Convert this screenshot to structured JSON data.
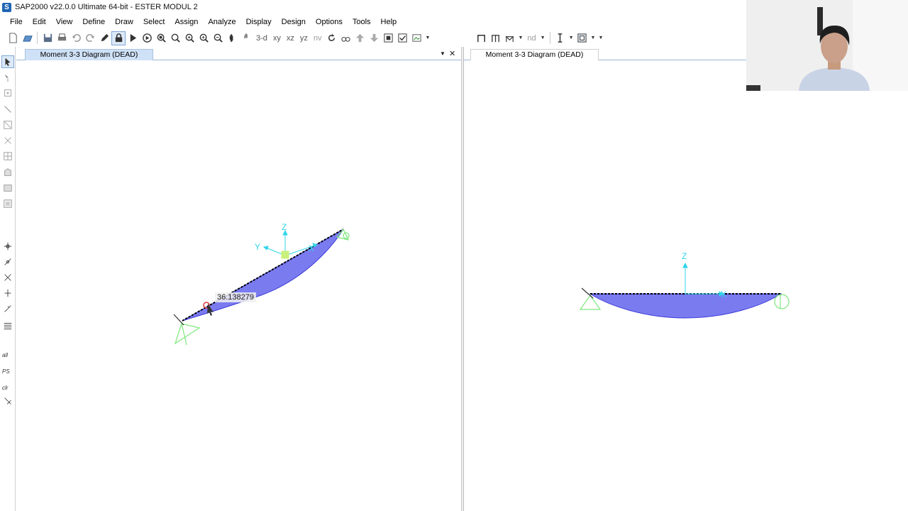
{
  "window": {
    "app_icon_letter": "S",
    "title": "SAP2000 v22.0.0 Ultimate 64-bit - ESTER MODUL 2"
  },
  "menu": {
    "items": [
      "File",
      "Edit",
      "View",
      "Define",
      "Draw",
      "Select",
      "Assign",
      "Analyze",
      "Display",
      "Design",
      "Options",
      "Tools",
      "Help"
    ]
  },
  "toolbar": {
    "view_3d": "3-d",
    "view_xy": "xy",
    "view_xz": "xz",
    "view_yz": "yz",
    "view_nv": "nv",
    "view_nd": "nd"
  },
  "palette": {
    "filter_all": "all",
    "filter_ps": "PS",
    "filter_clr": "clr"
  },
  "left_window": {
    "tab_label": "Moment 3-3 Diagram (DEAD)",
    "axis_z": "Z",
    "axis_y": "Y",
    "axis_x": "X",
    "hover_value": "36.138279"
  },
  "right_window": {
    "tab_label": "Moment 3-3 Diagram (DEAD)",
    "axis_z": "Z",
    "axis_x": "X"
  },
  "colors": {
    "moment_fill": "#7b7bf0",
    "moment_edge": "#3a3ad8",
    "axis": "#31d5e8",
    "support": "#7de87d",
    "tab_active": "#cfe1f6"
  }
}
